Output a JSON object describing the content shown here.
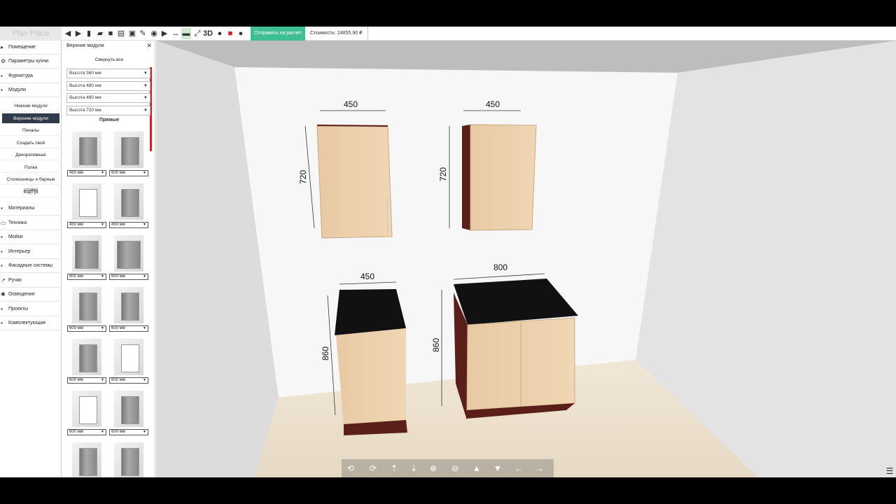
{
  "logo": "Plan Place",
  "toolbar": {
    "send_label": "Отправить на расчет",
    "cost": "Стоимость: 24855.90 ₽",
    "view3d_label": "3D"
  },
  "nav": {
    "items": [
      {
        "label": "Помещение",
        "icon": "room-icon"
      },
      {
        "label": "Параметры кухни",
        "icon": "settings-icon"
      },
      {
        "label": "Фурнитура",
        "icon": "hardware-icon"
      },
      {
        "label": "Модули",
        "icon": "modules-icon"
      }
    ],
    "sub_items": [
      "Нижние модули",
      "Верхние модули",
      "Пеналы",
      "Создать свой",
      "Декоративные",
      "Полки",
      "Столешницы и барные стойки",
      "Фартук"
    ],
    "items2": [
      {
        "label": "Материалы",
        "icon": "brush-icon"
      },
      {
        "label": "Техника",
        "icon": "appliance-icon"
      },
      {
        "label": "Мойки",
        "icon": "sink-icon"
      },
      {
        "label": "Интерьер",
        "icon": "interior-icon"
      },
      {
        "label": "Фасадные системы",
        "icon": "facade-icon"
      },
      {
        "label": "Ручки",
        "icon": "handle-icon"
      },
      {
        "label": "Освещение",
        "icon": "light-icon"
      },
      {
        "label": "Проекты",
        "icon": "projects-icon"
      },
      {
        "label": "Комплектующие",
        "icon": "cart-icon"
      }
    ]
  },
  "panel": {
    "title": "Верхние модули",
    "collapse_all": "Свернуть все",
    "heights": [
      "Высота 360 мм",
      "Высота 480 мм",
      "Высота 480 мм",
      "Высота 720 мм"
    ],
    "section": "Прямые",
    "sizes": [
      "450 мм",
      "600 мм",
      "450 мм",
      "450 мм",
      "800 мм",
      "800 мм",
      "600 мм",
      "600 мм",
      "600 мм",
      "600 мм",
      "800 мм",
      "600 мм"
    ]
  },
  "dimensions": {
    "upper_left_width": "450",
    "upper_left_height": "720",
    "upper_right_width": "450",
    "upper_right_height": "720",
    "lower_left_width": "450",
    "lower_left_height": "860",
    "lower_right_width": "800",
    "lower_right_height": "860"
  }
}
